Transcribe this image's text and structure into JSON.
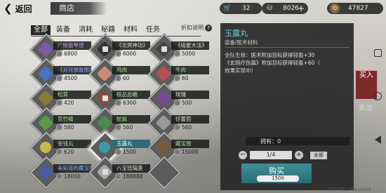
{
  "topbar": {
    "back_label": "返回",
    "title": "商店",
    "res1_value": "32",
    "res2_value": "8026",
    "res3_value": "47827",
    "plus": "+"
  },
  "tabs": [
    "全部",
    "装备",
    "消耗",
    "秘籍",
    "材料",
    "任务"
  ],
  "discount_label": "折扣说明",
  "items": [
    {
      "name": "广陵散琴谱",
      "price": "6800",
      "color": "#7b5aa8"
    },
    {
      "name": "《北冥神功》",
      "price": "6000",
      "color": "#444"
    },
    {
      "name": "《吸星大法》",
      "price": "5000",
      "color": "#555"
    },
    {
      "name": "《对月放歌图》",
      "price": "4500",
      "color": "#4b6fc5"
    },
    {
      "name": "鸡肉",
      "price": "60",
      "color": "#c98a7a"
    },
    {
      "name": "牛肉",
      "price": "60",
      "color": "#b5504f"
    },
    {
      "name": "松茸",
      "price": "420",
      "color": "#8a7a3a"
    },
    {
      "name": "极品血蟾",
      "price": "6300",
      "color": "#8a4a3a"
    },
    {
      "name": "玫瑰",
      "price": "500",
      "color": "#7a4a9a"
    },
    {
      "name": "贡竹橘",
      "price": "580",
      "color": "#5a9a4a"
    },
    {
      "name": "蛇蜕",
      "price": "560",
      "color": "#4a8a4a"
    },
    {
      "name": "仔姜茴",
      "price": "560",
      "color": "#9a9a9a"
    },
    {
      "name": "金钱丸",
      "price": "620",
      "color": "#c8b84a"
    },
    {
      "name": "玉露丸",
      "price": "1500",
      "color": "#3a9aa8"
    },
    {
      "name": "藏宝图",
      "price": "15000",
      "color": "#7a5a3a"
    },
    {
      "name": "未知道的藏宝图",
      "price": "18000",
      "color": "#4a5aa8"
    },
    {
      "name": "八宝琉璃盏",
      "price": "188888",
      "color": "#aaa"
    },
    {
      "name": "",
      "price": "",
      "color": "#5c5c5c"
    }
  ],
  "panel": {
    "title": "玉露丸",
    "type": "装备/医术材料",
    "desc_line1": "全队生效：医术附加目标获得轻盈+30",
    "desc_line2": "《玄阴疗伤篇》附加目标获得轻盈+60（",
    "desc_line3": "效果实现中）",
    "owned": "拥有：0",
    "qty": "1/4",
    "minus": "−",
    "plus": "+",
    "all": "全部",
    "buy_label": "购买",
    "buy_price": "1500"
  },
  "rtabs": {
    "buy": "买入",
    "sell": "卖出"
  },
  "footer": "打包不需1 249/15894"
}
